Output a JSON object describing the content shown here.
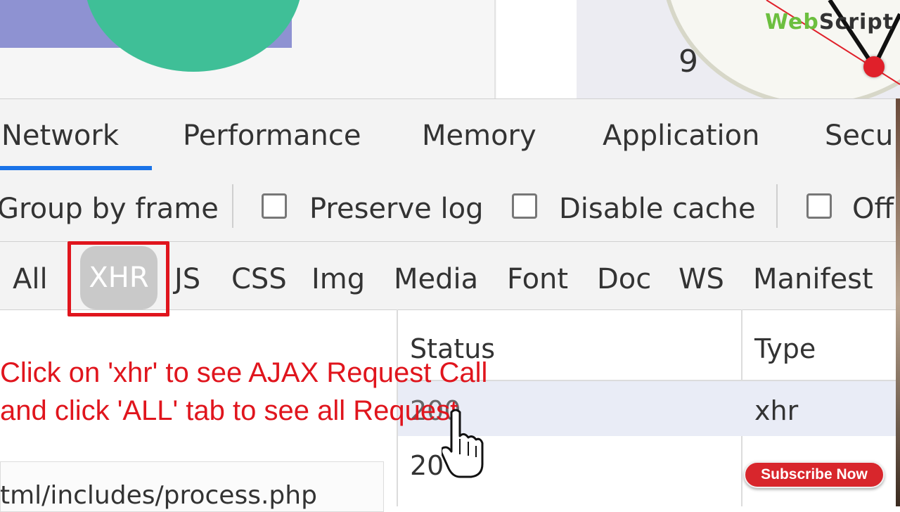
{
  "brand": {
    "part1": "Web",
    "part2": "Script"
  },
  "clock": {
    "number": "9"
  },
  "tabs": [
    "Network",
    "Performance",
    "Memory",
    "Application",
    "Secur"
  ],
  "toolbar": {
    "group_by_frame": "Group by frame",
    "preserve_log": "Preserve log",
    "disable_cache": "Disable cache",
    "offline": "Off"
  },
  "filters": {
    "all": "All",
    "xhr": "XHR",
    "js": "JS",
    "css": "CSS",
    "img": "Img",
    "media": "Media",
    "font": "Font",
    "doc": "Doc",
    "ws": "WS",
    "manifest": "Manifest"
  },
  "table": {
    "headers": {
      "status": "Status",
      "type": "Type"
    },
    "rows": [
      {
        "status": "200",
        "type": "xhr"
      },
      {
        "status": "20"
      }
    ],
    "url_fragment": "tml/includes/process.php"
  },
  "annotation": {
    "line1": "Click on 'xhr' to see AJAX Request Call",
    "line2": " and click 'ALL' tab to see all Request"
  },
  "subscribe_label": "Subscribe Now",
  "colors": {
    "accent": "#1a73e8",
    "annotation": "#e0151d",
    "subscribe": "#d8262c",
    "brand_green": "#6cbf3f"
  }
}
